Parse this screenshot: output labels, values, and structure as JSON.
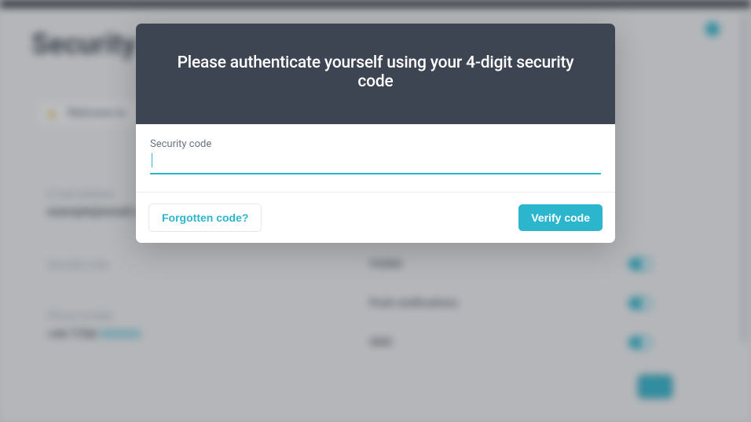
{
  "background": {
    "page_title": "Security",
    "warning_text": "Welcome to",
    "field1_label": "E-mail address",
    "field1_value": "example@email.com",
    "field2_label": "Security code",
    "field3_label": "Phone number",
    "field3_value_prefix": "+44 7700",
    "field3_value_link": "900000",
    "col2_row1_label": "Visible",
    "col2_row2_label": "Push notifications",
    "col2_row3_label": "SMS"
  },
  "modal": {
    "title": "Please authenticate yourself using your 4-digit security code",
    "field_label": "Security code",
    "field_value": "",
    "forgotten_label": "Forgotten code?",
    "verify_label": "Verify code"
  }
}
